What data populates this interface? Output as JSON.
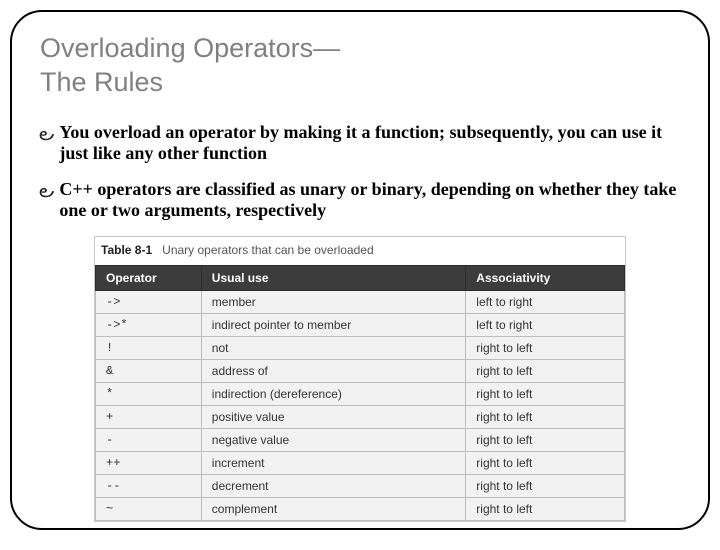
{
  "title_line1": "Overloading Operators—",
  "title_line2": "The Rules",
  "bullets": [
    "You overload an operator by making it a function; subsequently, you can use it just like any other function",
    "C++ operators are classified as unary or binary, depending on whether they take one or two arguments, respectively"
  ],
  "table_label": "Table 8-1",
  "table_caption": "Unary operators that can be overloaded",
  "headers": [
    "Operator",
    "Usual use",
    "Associativity"
  ],
  "rows": [
    {
      "op": "->",
      "use": "member",
      "assoc": "left to right"
    },
    {
      "op": "->*",
      "use": "indirect pointer to member",
      "assoc": "left to right"
    },
    {
      "op": "!",
      "use": "not",
      "assoc": "right to left"
    },
    {
      "op": "&",
      "use": "address of",
      "assoc": "right to left"
    },
    {
      "op": "*",
      "use": "indirection (dereference)",
      "assoc": "right to left"
    },
    {
      "op": "+",
      "use": "positive value",
      "assoc": "right to left"
    },
    {
      "op": "-",
      "use": "negative value",
      "assoc": "right to left"
    },
    {
      "op": "++",
      "use": "increment",
      "assoc": "right to left"
    },
    {
      "op": "--",
      "use": "decrement",
      "assoc": "right to left"
    },
    {
      "op": "~",
      "use": "complement",
      "assoc": "right to left"
    }
  ]
}
